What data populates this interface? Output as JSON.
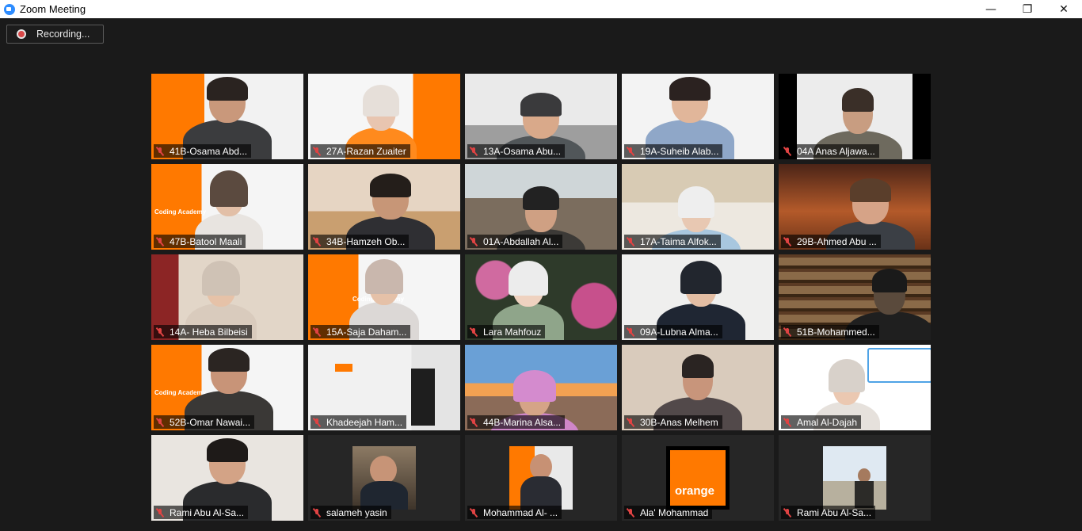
{
  "window": {
    "title": "Zoom Meeting",
    "minimize": "—",
    "restore": "❐",
    "close": "✕"
  },
  "recording": {
    "label": "Recording..."
  },
  "brand": {
    "coding_academy": "Coding Academy",
    "orange_logo": "orange"
  },
  "participants": [
    {
      "name": "41B-Osama Abd..."
    },
    {
      "name": "27A-Razan Zuaiter"
    },
    {
      "name": "13A-Osama Abu..."
    },
    {
      "name": "19A-Suheib Alab..."
    },
    {
      "name": "04A Anas Aljawa..."
    },
    {
      "name": "47B-Batool Maali"
    },
    {
      "name": "34B-Hamzeh Ob..."
    },
    {
      "name": "01A-Abdallah Al..."
    },
    {
      "name": "17A-Taima Alfok..."
    },
    {
      "name": "29B-Ahmed Abu ..."
    },
    {
      "name": "14A- Heba Bilbeisi"
    },
    {
      "name": "15A-Saja Daham..."
    },
    {
      "name": "Lara Mahfouz"
    },
    {
      "name": "09A-Lubna Alma..."
    },
    {
      "name": "51B-Mohammed..."
    },
    {
      "name": "52B-Omar Nawai..."
    },
    {
      "name": "Khadeejah Ham..."
    },
    {
      "name": "44B-Marina Alsa..."
    },
    {
      "name": "30B-Anas Melhem"
    },
    {
      "name": "Amal Al-Dajah"
    },
    {
      "name": "Rami Abu Al-Sa..."
    },
    {
      "name": "salameh yasin"
    },
    {
      "name": "Mohammad Al- ..."
    },
    {
      "name": "Ala' Mohammad"
    },
    {
      "name": "Rami Abu Al-Sa..."
    }
  ],
  "colors": {
    "brand_orange": "#ff7900",
    "muted_mic": "#e04343",
    "app_blue": "#2d8cff"
  }
}
